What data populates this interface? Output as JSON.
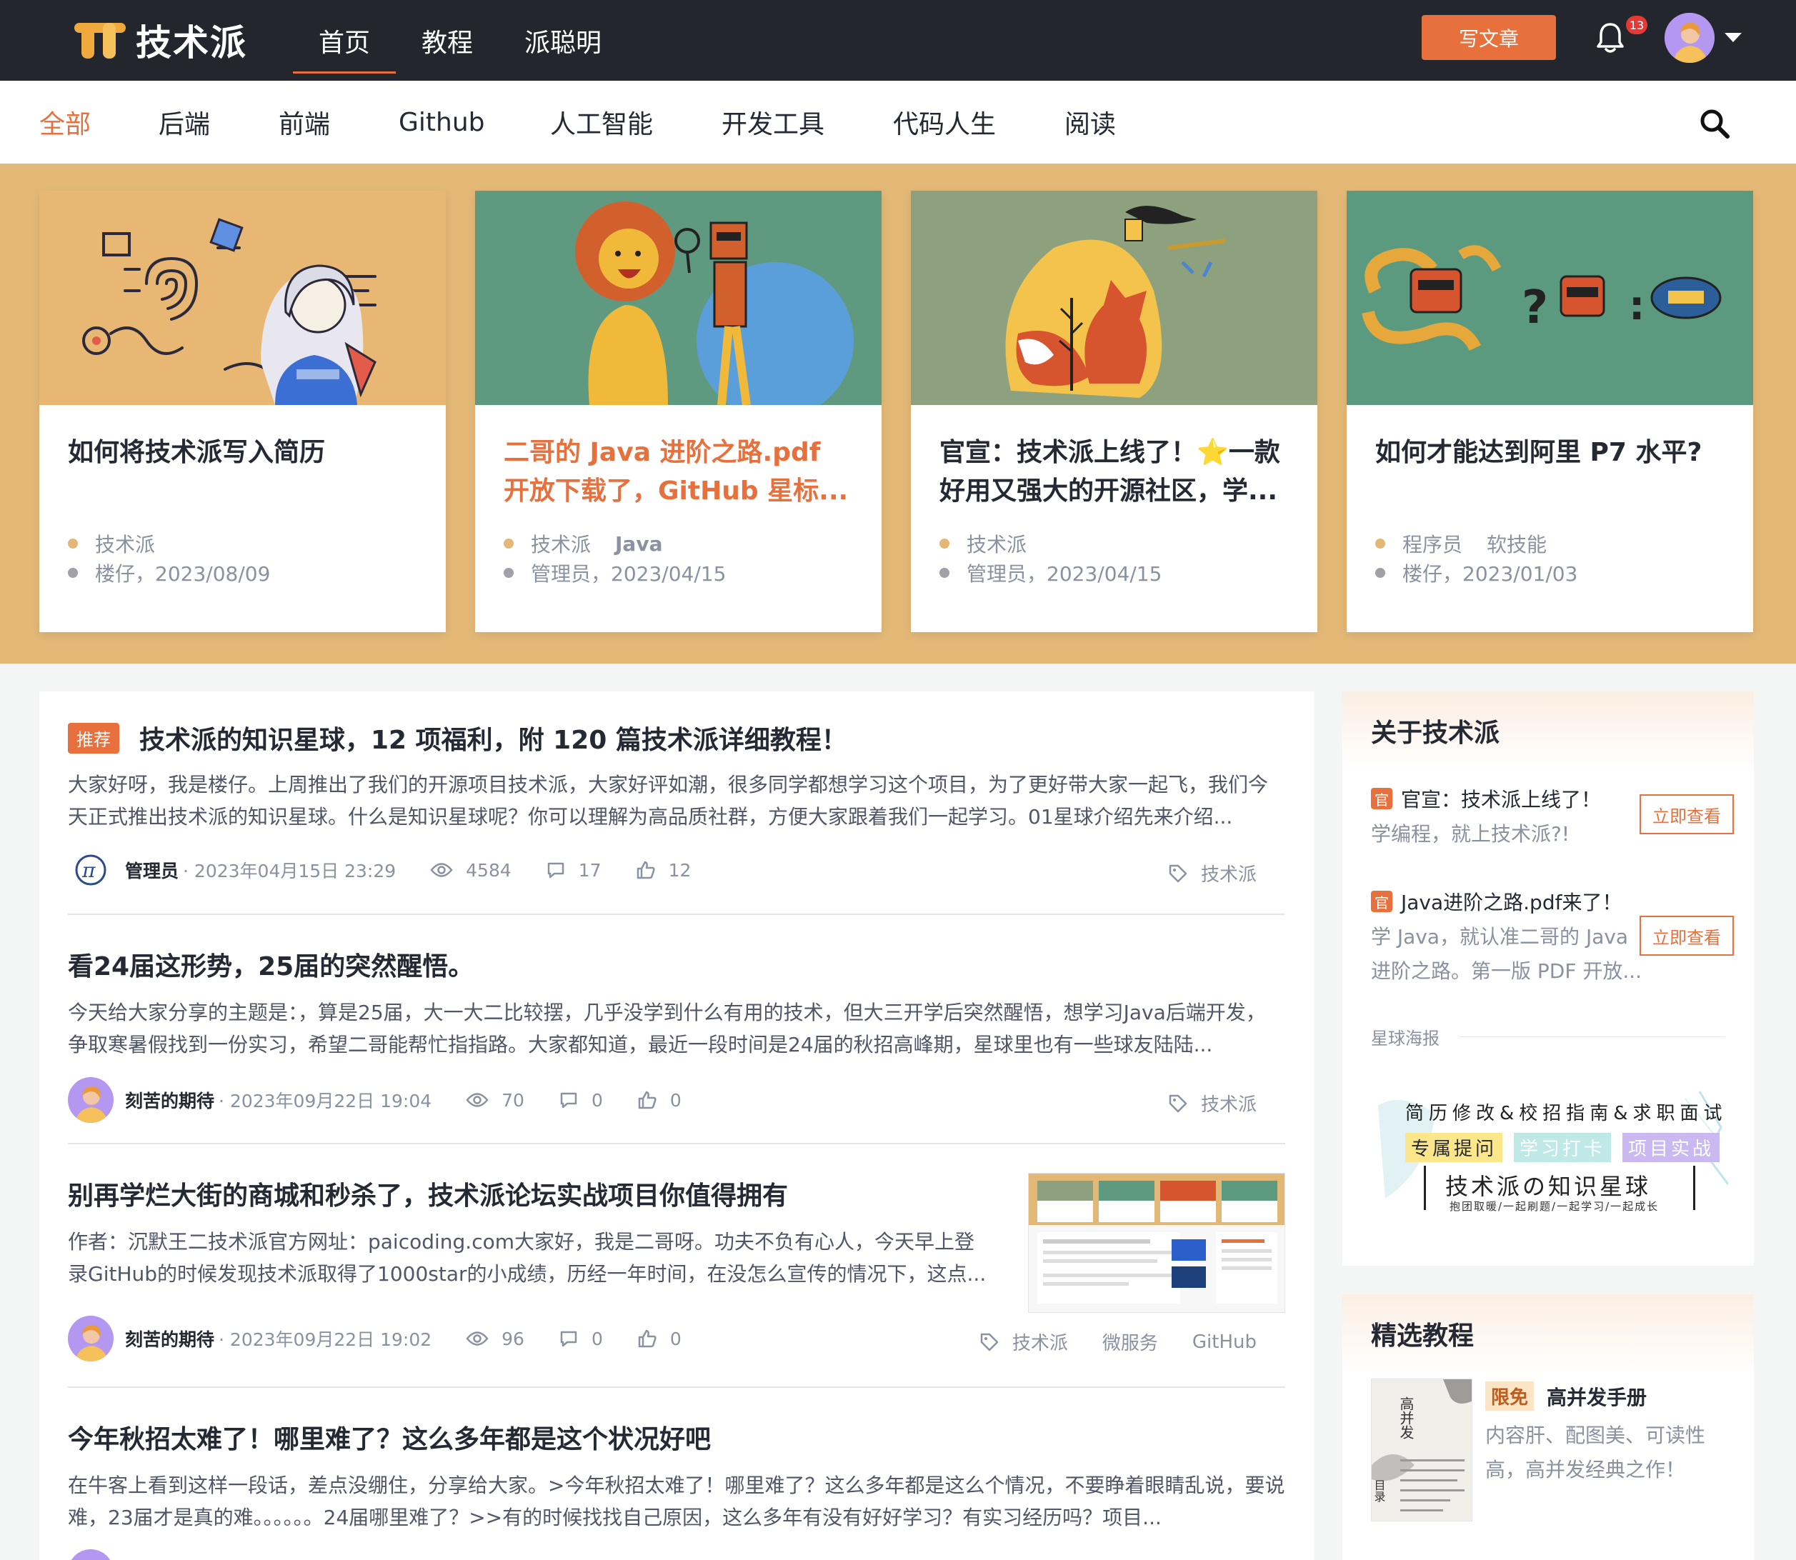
{
  "header": {
    "logo_text": "技术派",
    "nav": [
      "首页",
      "教程",
      "派聪明"
    ],
    "write_label": "写文章",
    "notification_count": "13",
    "brand_color": "#e8703c"
  },
  "categories": [
    "全部",
    "后端",
    "前端",
    "Github",
    "人工智能",
    "开发工具",
    "代码人生",
    "阅读"
  ],
  "banner_cards": [
    {
      "title": "如何将技术派写入简历",
      "tags": "技术派",
      "author_date": "楼仔，2023/08/09"
    },
    {
      "title": "二哥的 Java 进阶之路.pdf 开放下载了，GitHub 星标...",
      "tags": "技术派",
      "tag2": "Java",
      "author_date": "管理员，2023/04/15"
    },
    {
      "title": "官宣：技术派上线了！⭐一款好用又强大的开源社区，学...",
      "tags": "技术派",
      "author_date": "管理员，2023/04/15"
    },
    {
      "title": "如何才能达到阿里 P7 水平?",
      "tags": "程序员",
      "tag2": "软技能",
      "author_date": "楼仔，2023/01/03"
    }
  ],
  "articles": [
    {
      "badge": "推荐",
      "title": "技术派的知识星球，12 项福利，附 120 篇技术派详细教程！",
      "abstract": "大家好呀，我是楼仔。上周推出了我们的开源项目技术派，大家好评如潮，很多同学都想学习这个项目，为了更好带大家一起飞，我们今天正式推出技术派的知识星球。什么是知识星球呢？你可以理解为高品质社群，方便大家跟着我们一起学习。01星球介绍先来介绍...",
      "author": "管理员",
      "time": "· 2023年04月15日 23:29",
      "views": "4584",
      "comments": "17",
      "likes": "12",
      "tags": [
        "技术派"
      ]
    },
    {
      "title": "看24届这形势，25届的突然醒悟。",
      "abstract": "今天给大家分享的主题是：，算是25届，大一大二比较摆，几乎没学到什么有用的技术，但大三开学后突然醒悟，想学习Java后端开发，争取寒暑假找到一份实习，希望二哥能帮忙指指路。大家都知道，最近一段时间是24届的秋招高峰期，星球里也有一些球友陆陆...",
      "author": "刻苦的期待",
      "time": "· 2023年09月22日 19:04",
      "views": "70",
      "comments": "0",
      "likes": "0",
      "tags": [
        "技术派"
      ]
    },
    {
      "title": "别再学烂大街的商城和秒杀了，技术派论坛实战项目你值得拥有",
      "abstract": "作者：沉默王二技术派官方网址：paicoding.com大家好，我是二哥呀。功夫不负有心人，今天早上登录GitHub的时候发现技术派取得了1000star的小成绩，历经一年时间，在没怎么宣传的情况下，这点...",
      "author": "刻苦的期待",
      "time": "· 2023年09月22日 19:02",
      "views": "96",
      "comments": "0",
      "likes": "0",
      "tags": [
        "技术派",
        "微服务",
        "GitHub"
      ]
    },
    {
      "title": "今年秋招太难了！哪里难了？这么多年都是这个状况好吧",
      "abstract": "在牛客上看到这样一段话，差点没绷住，分享给大家。>今年秋招太难了！哪里难了？这么多年都是这么个情况，不要睁着眼睛乱说，要说难，23届才是真的难。。。。。。24届哪里难了？>>有的时候找找自己原因，这么多年有没有好好学习？有实习经历吗？项目..."
    }
  ],
  "about": {
    "title": "关于技术派",
    "official_mark": "官",
    "promos": [
      {
        "title": "官宣：技术派上线了！",
        "desc": "学编程，就上技术派?!",
        "button": "立即查看"
      },
      {
        "title": "Java进阶之路.pdf来了！",
        "desc": "学 Java，就认准二哥的 Java 进阶之路。第一版 PDF 开放...",
        "button": "立即查看"
      }
    ],
    "poster_label": "星球海报",
    "poster": {
      "line1": "简历修改&校招指南&求职面试",
      "chips": [
        "专属提问",
        "学习打卡",
        "项目实战"
      ],
      "name": "技术派の知识星球",
      "slogan": "抱团取暖/一起刷题/一起学习/一起成长"
    }
  },
  "courses": {
    "title": "精选教程",
    "items": [
      {
        "badge": "限免",
        "name": "高并发手册",
        "desc": "内容肝、配图美、可读性高，高并发经典之作！",
        "cover_title": "高并发",
        "cover_toc": "目录"
      }
    ]
  }
}
